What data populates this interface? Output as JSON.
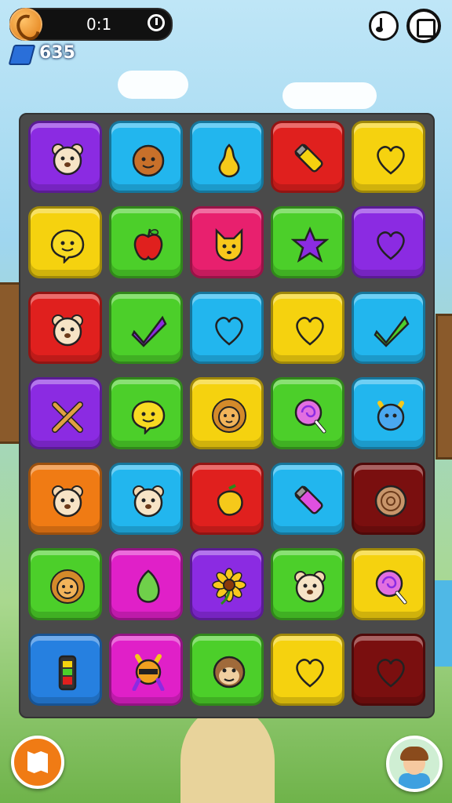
{
  "hud": {
    "score": "0:1",
    "gems": "635"
  },
  "board": {
    "rows": [
      [
        {
          "color": "#8b2be2",
          "icon": "bear-face-icon"
        },
        {
          "color": "#22b6ee",
          "icon": "coconut-face-icon"
        },
        {
          "color": "#22b6ee",
          "icon": "pear-icon"
        },
        {
          "color": "#e0201e",
          "icon": "marker-icon"
        },
        {
          "color": "#f5d20f",
          "icon": "heart-icon"
        }
      ],
      [
        {
          "color": "#f5d20f",
          "icon": "speech-bubble-face-icon"
        },
        {
          "color": "#4ccf2a",
          "icon": "apple-icon"
        },
        {
          "color": "#e8206e",
          "icon": "fox-face-icon"
        },
        {
          "color": "#4ccf2a",
          "icon": "star-icon"
        },
        {
          "color": "#8b2be2",
          "icon": "heart-icon"
        }
      ],
      [
        {
          "color": "#e0201e",
          "icon": "bear-face-icon"
        },
        {
          "color": "#4ccf2a",
          "icon": "check-mark-icon"
        },
        {
          "color": "#22b6ee",
          "icon": "heart-icon"
        },
        {
          "color": "#f5d20f",
          "icon": "heart-icon"
        },
        {
          "color": "#22b6ee",
          "icon": "check-mark-icon"
        }
      ],
      [
        {
          "color": "#8b2be2",
          "icon": "crossed-tools-icon"
        },
        {
          "color": "#4ccf2a",
          "icon": "speech-bubble-face-icon"
        },
        {
          "color": "#f5d20f",
          "icon": "lion-face-icon"
        },
        {
          "color": "#4ccf2a",
          "icon": "lollipop-icon"
        },
        {
          "color": "#22b6ee",
          "icon": "blue-creature-icon"
        }
      ],
      [
        {
          "color": "#f07b14",
          "icon": "bear-face-icon"
        },
        {
          "color": "#22b6ee",
          "icon": "bear-face-icon"
        },
        {
          "color": "#e0201e",
          "icon": "mango-icon"
        },
        {
          "color": "#22b6ee",
          "icon": "marker-icon"
        },
        {
          "color": "#7a0f0f",
          "icon": "wood-log-icon"
        }
      ],
      [
        {
          "color": "#4ccf2a",
          "icon": "lion-face-icon"
        },
        {
          "color": "#e020c8",
          "icon": "papaya-icon"
        },
        {
          "color": "#8b2be2",
          "icon": "sunflower-icon"
        },
        {
          "color": "#4ccf2a",
          "icon": "bear-face-icon"
        },
        {
          "color": "#f5d20f",
          "icon": "lollipop-icon"
        }
      ],
      [
        {
          "color": "#2680e0",
          "icon": "battery-icon"
        },
        {
          "color": "#e020c8",
          "icon": "robot-creature-icon"
        },
        {
          "color": "#4ccf2a",
          "icon": "monkey-face-icon"
        },
        {
          "color": "#f5d20f",
          "icon": "heart-icon"
        },
        {
          "color": "#7a0f0f",
          "icon": "heart-icon"
        }
      ]
    ]
  }
}
